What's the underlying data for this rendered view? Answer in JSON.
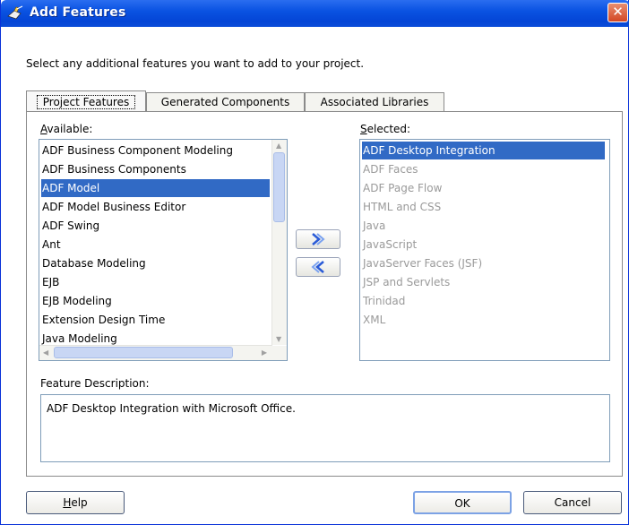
{
  "window": {
    "title": "Add Features",
    "close_symbol": "✕",
    "title_icon": "feature-plug-icon"
  },
  "instruction": "Select any additional features you want to add to your project.",
  "tabs": [
    {
      "label": "Project Features",
      "active": true
    },
    {
      "label": "Generated Components",
      "active": false
    },
    {
      "label": "Associated Libraries",
      "active": false
    }
  ],
  "available": {
    "label_mnemonic": "A",
    "label_rest": "vailable:",
    "items": [
      "ADF Business Component Modeling",
      "ADF Business Components",
      "ADF Model",
      "ADF Model Business Editor",
      "ADF Swing",
      "Ant",
      "Database Modeling",
      "EJB",
      "EJB Modeling",
      "Extension Design Time",
      "Java Modeling"
    ],
    "selected_index": 2
  },
  "selected": {
    "label_mnemonic": "S",
    "label_rest": "elected:",
    "items": [
      "ADF Desktop Integration",
      "ADF Faces",
      "ADF Page Flow",
      "HTML and CSS",
      "Java",
      "JavaScript",
      "JavaServer Faces (JSF)",
      "JSP and Servlets",
      "Trinidad",
      "XML"
    ],
    "selected_index": 0
  },
  "move_buttons": {
    "add_icon": "double-chevron-right-icon",
    "remove_icon": "double-chevron-left-icon"
  },
  "description": {
    "label": "Feature Description:",
    "text": "ADF Desktop Integration with Microsoft Office."
  },
  "buttons": {
    "help_mnemonic": "H",
    "help_rest": "elp",
    "ok": "OK",
    "cancel": "Cancel"
  },
  "colors": {
    "selection": "#316ac5",
    "titlebar": "#0a53e2",
    "disabled_text": "#9a9a9a"
  }
}
